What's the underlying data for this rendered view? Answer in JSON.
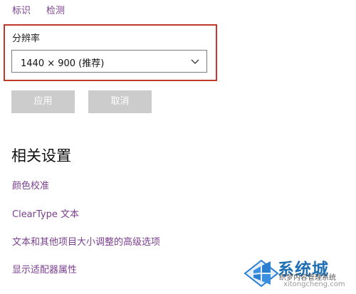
{
  "top_links": [
    "标识",
    "检测"
  ],
  "resolution": {
    "label": "分辨率",
    "value": "1440 × 900 (推荐)"
  },
  "buttons": {
    "apply": "应用",
    "cancel": "取消"
  },
  "related": {
    "title": "相关设置",
    "links": [
      "颜色校准",
      "ClearType 文本",
      "文本和其他项目大小调整的高级选项",
      "显示适配器属性"
    ]
  },
  "watermark": {
    "brand": "系统城",
    "sub": "织梦内容管理系统",
    "site": "xitongcheng.com"
  },
  "colors": {
    "link": "#7a3f8f",
    "highlight": "#c0392b",
    "button_disabled": "#cccccc"
  }
}
